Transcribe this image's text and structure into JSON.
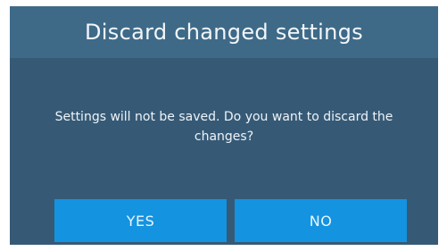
{
  "dialog": {
    "title": "Discard changed settings",
    "message": "Settings will not be saved. Do you want to discard the changes?",
    "buttons": {
      "yes_label": "YES",
      "no_label": "NO"
    }
  },
  "colors": {
    "dialog_background": "#365a76",
    "title_bar_background": "#3e6a88",
    "button_background": "#1493e0",
    "text": "#ffffff"
  }
}
